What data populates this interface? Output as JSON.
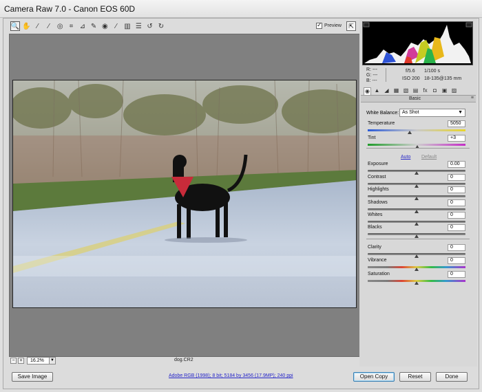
{
  "window": {
    "title": "Camera Raw 7.0  -  Canon EOS 60D"
  },
  "toolbar": {
    "tools": [
      {
        "name": "zoom-tool",
        "glyph": "🔍"
      },
      {
        "name": "hand-tool",
        "glyph": "✋"
      },
      {
        "name": "white-balance-tool",
        "glyph": "⁄"
      },
      {
        "name": "color-sampler-tool",
        "glyph": "⁄"
      },
      {
        "name": "targeted-adjustment-tool",
        "glyph": "◎"
      },
      {
        "name": "crop-tool",
        "glyph": "⌗"
      },
      {
        "name": "straighten-tool",
        "glyph": "⊿"
      },
      {
        "name": "spot-removal-tool",
        "glyph": "✎"
      },
      {
        "name": "red-eye-removal-tool",
        "glyph": "◉"
      },
      {
        "name": "adjustment-brush-tool",
        "glyph": "⁄"
      },
      {
        "name": "graduated-filter-tool",
        "glyph": "▥"
      },
      {
        "name": "preferences-tool",
        "glyph": "☰"
      },
      {
        "name": "rotate-left-tool",
        "glyph": "↺"
      },
      {
        "name": "rotate-right-tool",
        "glyph": "↻"
      }
    ],
    "preview_label": "Preview",
    "preview_checked": true,
    "fullscreen_glyph": "⇱"
  },
  "status": {
    "zoom_out": "−",
    "zoom_in": "+",
    "zoom_value": "16.2%",
    "filename": "dog.CR2"
  },
  "readout": {
    "r": "R:   ---",
    "g": "G:   ---",
    "b": "B:   ---",
    "aperture": "f/5.6",
    "shutter": "1/100 s",
    "iso": "ISO 200",
    "lens": "18-135@135 mm"
  },
  "panel": {
    "title": "Basic",
    "menu_glyph": "≡",
    "tabs": [
      "◉",
      "▲",
      "◢",
      "▦",
      "▧",
      "▤",
      "fx",
      "◘",
      "▣",
      "▨"
    ],
    "white_balance_label": "White Balance:",
    "white_balance_value": "As Shot",
    "temperature": {
      "label": "Temperature",
      "value": "5050",
      "pos": 0.43
    },
    "tint": {
      "label": "Tint",
      "value": "+3",
      "pos": 0.51
    },
    "auto_label": "Auto",
    "default_label": "Default",
    "exposure": {
      "label": "Exposure",
      "value": "0.00",
      "pos": 0.5
    },
    "contrast": {
      "label": "Contrast",
      "value": "0",
      "pos": 0.5
    },
    "highlights": {
      "label": "Highlights",
      "value": "0",
      "pos": 0.5
    },
    "shadows": {
      "label": "Shadows",
      "value": "0",
      "pos": 0.5
    },
    "whites": {
      "label": "Whites",
      "value": "0",
      "pos": 0.5
    },
    "blacks": {
      "label": "Blacks",
      "value": "0",
      "pos": 0.5
    },
    "clarity": {
      "label": "Clarity",
      "value": "0",
      "pos": 0.5
    },
    "vibrance": {
      "label": "Vibrance",
      "value": "0",
      "pos": 0.5
    },
    "saturation": {
      "label": "Saturation",
      "value": "0",
      "pos": 0.5
    }
  },
  "footer": {
    "save_image": "Save Image",
    "workflow": "Adobe RGB (1998); 8 bit; 5184 by 3456 (17.9MP); 240 ppi",
    "open_copy": "Open Copy",
    "reset": "Reset",
    "done": "Done"
  },
  "colors": {
    "link": "#2626c8",
    "canvas": "#808080",
    "panel": "#d8d8d8"
  }
}
